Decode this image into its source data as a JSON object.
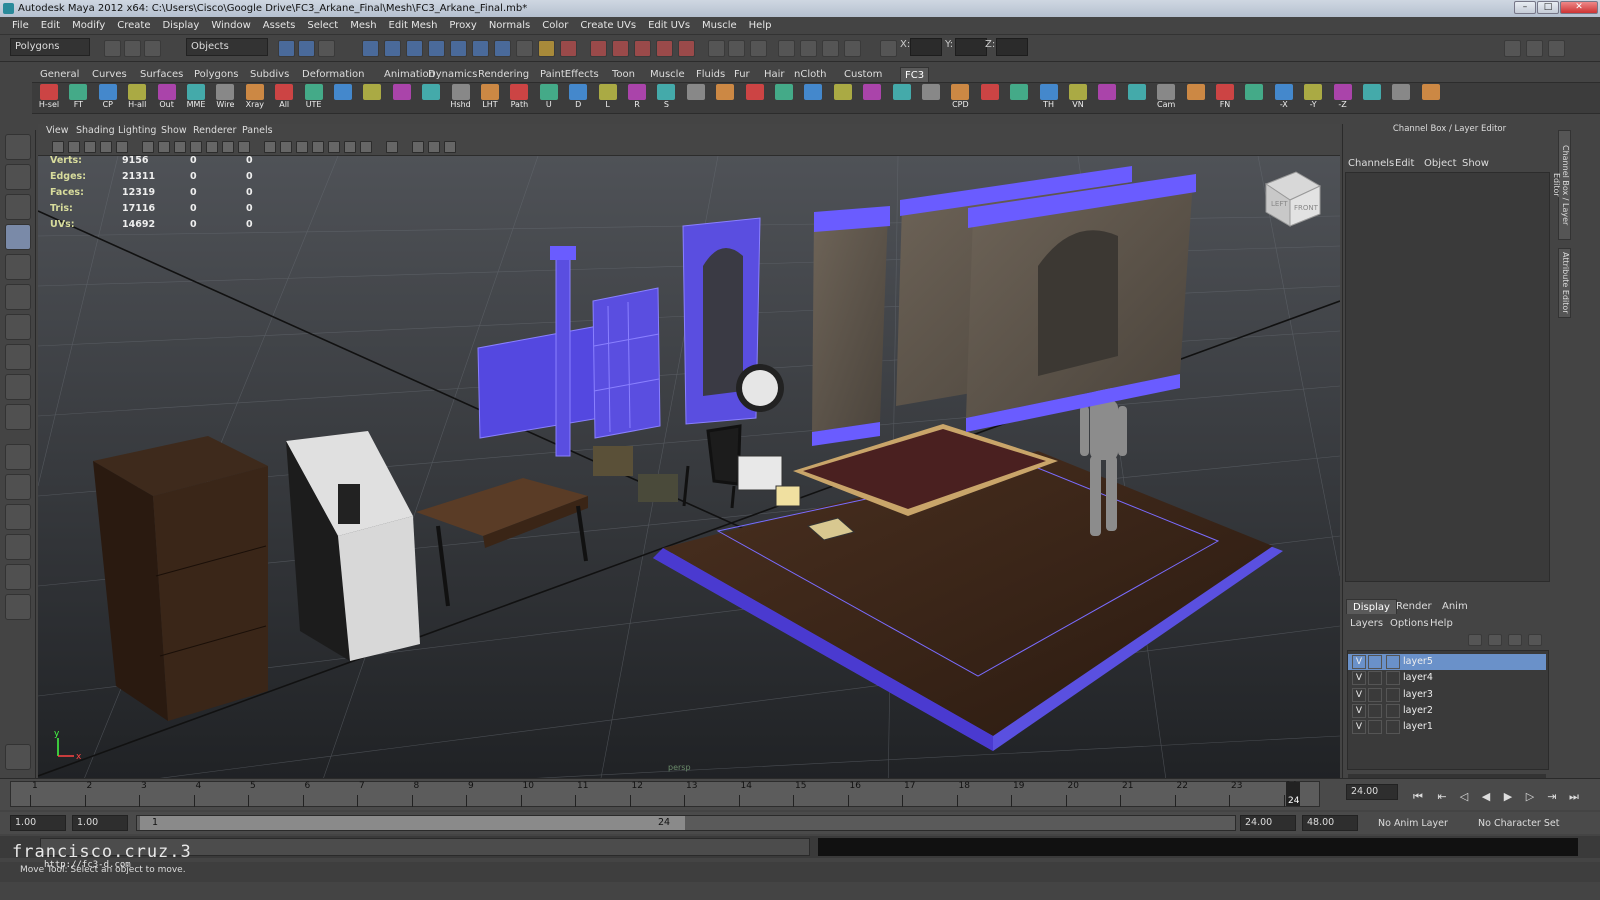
{
  "window": {
    "title": "Autodesk Maya 2012 x64: C:\\Users\\Cisco\\Google Drive\\FC3_Arkane_Final\\Mesh\\FC3_Arkane_Final.mb*"
  },
  "menubar": [
    "File",
    "Edit",
    "Modify",
    "Create",
    "Display",
    "Window",
    "Assets",
    "Select",
    "Mesh",
    "Edit Mesh",
    "Proxy",
    "Normals",
    "Color",
    "Create UVs",
    "Edit UVs",
    "Muscle",
    "Help"
  ],
  "statusline": {
    "mode": "Polygons",
    "selection": "Objects",
    "x_label": "X:",
    "y_label": "Y:",
    "z_label": "Z:"
  },
  "shelf_tabs": [
    "General",
    "Curves",
    "Surfaces",
    "Polygons",
    "Subdivs",
    "Deformation",
    "Animation",
    "Dynamics",
    "Rendering",
    "PaintEffects",
    "Toon",
    "Muscle",
    "Fluids",
    "Fur",
    "Hair",
    "nCloth",
    "Custom",
    "FC3"
  ],
  "shelf_active": "FC3",
  "shelf_buttons": [
    "H-sel",
    "FT",
    "CP",
    "H-all",
    "Out",
    "MME",
    "Wire",
    "Xray",
    "All",
    "UTE",
    "",
    "",
    "",
    "",
    "Hshd",
    "LHT",
    "Path",
    "U",
    "D",
    "L",
    "R",
    "S",
    "",
    "",
    "",
    "",
    "",
    "",
    "",
    "",
    "",
    "CPD",
    "",
    "",
    "TH",
    "VN",
    "",
    "",
    "Cam",
    "",
    "FN",
    "",
    "-X",
    "-Y",
    "-Z",
    "",
    "",
    ""
  ],
  "viewport": {
    "menus": [
      "View",
      "Shading",
      "Lighting",
      "Show",
      "Renderer",
      "Panels"
    ],
    "hud": [
      {
        "label": "Verts:",
        "v1": "9156",
        "v2": "0",
        "v3": "0"
      },
      {
        "label": "Edges:",
        "v1": "21311",
        "v2": "0",
        "v3": "0"
      },
      {
        "label": "Faces:",
        "v1": "12319",
        "v2": "0",
        "v3": "0"
      },
      {
        "label": "Tris:",
        "v1": "17116",
        "v2": "0",
        "v3": "0"
      },
      {
        "label": "UVs:",
        "v1": "14692",
        "v2": "0",
        "v3": "0"
      }
    ],
    "camera": "persp",
    "viewcube": {
      "left": "LEFT",
      "front": "FRONT"
    },
    "axis": {
      "x": "x",
      "y": "y"
    }
  },
  "channel_box": {
    "title": "Channel Box / Layer Editor",
    "menus": [
      "Channels",
      "Edit",
      "Object",
      "Show"
    ],
    "side_tabs": [
      "Channel Box / Layer Editor",
      "Attribute Editor"
    ]
  },
  "layer_editor": {
    "tabs": [
      "Display",
      "Render",
      "Anim"
    ],
    "menus": [
      "Layers",
      "Options",
      "Help"
    ],
    "layers": [
      {
        "v": "V",
        "name": "layer5",
        "selected": true
      },
      {
        "v": "V",
        "name": "layer4",
        "selected": false
      },
      {
        "v": "V",
        "name": "layer3",
        "selected": false
      },
      {
        "v": "V",
        "name": "layer2",
        "selected": false
      },
      {
        "v": "V",
        "name": "layer1",
        "selected": false
      }
    ]
  },
  "timeslider": {
    "ticks": [
      "1",
      "2",
      "3",
      "4",
      "5",
      "6",
      "7",
      "8",
      "9",
      "10",
      "11",
      "12",
      "13",
      "14",
      "15",
      "16",
      "17",
      "18",
      "19",
      "20",
      "21",
      "22",
      "23",
      "24"
    ],
    "current_frame_marker": "24",
    "current_time": "24.00"
  },
  "range": {
    "start": "1.00",
    "playback_start": "1.00",
    "slider_start": "1",
    "slider_end": "24",
    "playback_end": "24.00",
    "end": "48.00",
    "anim_layer": "No Anim Layer",
    "character_set": "No Character Set"
  },
  "helpline": "Move Tool: Select an object to move.",
  "watermark": {
    "name": "francisco.cruz.3",
    "url": "http://fc3-d.com"
  },
  "colors": {
    "selected_layer": "#6a91c9",
    "wire": "#6a5cff",
    "floor": "#3a2418"
  }
}
